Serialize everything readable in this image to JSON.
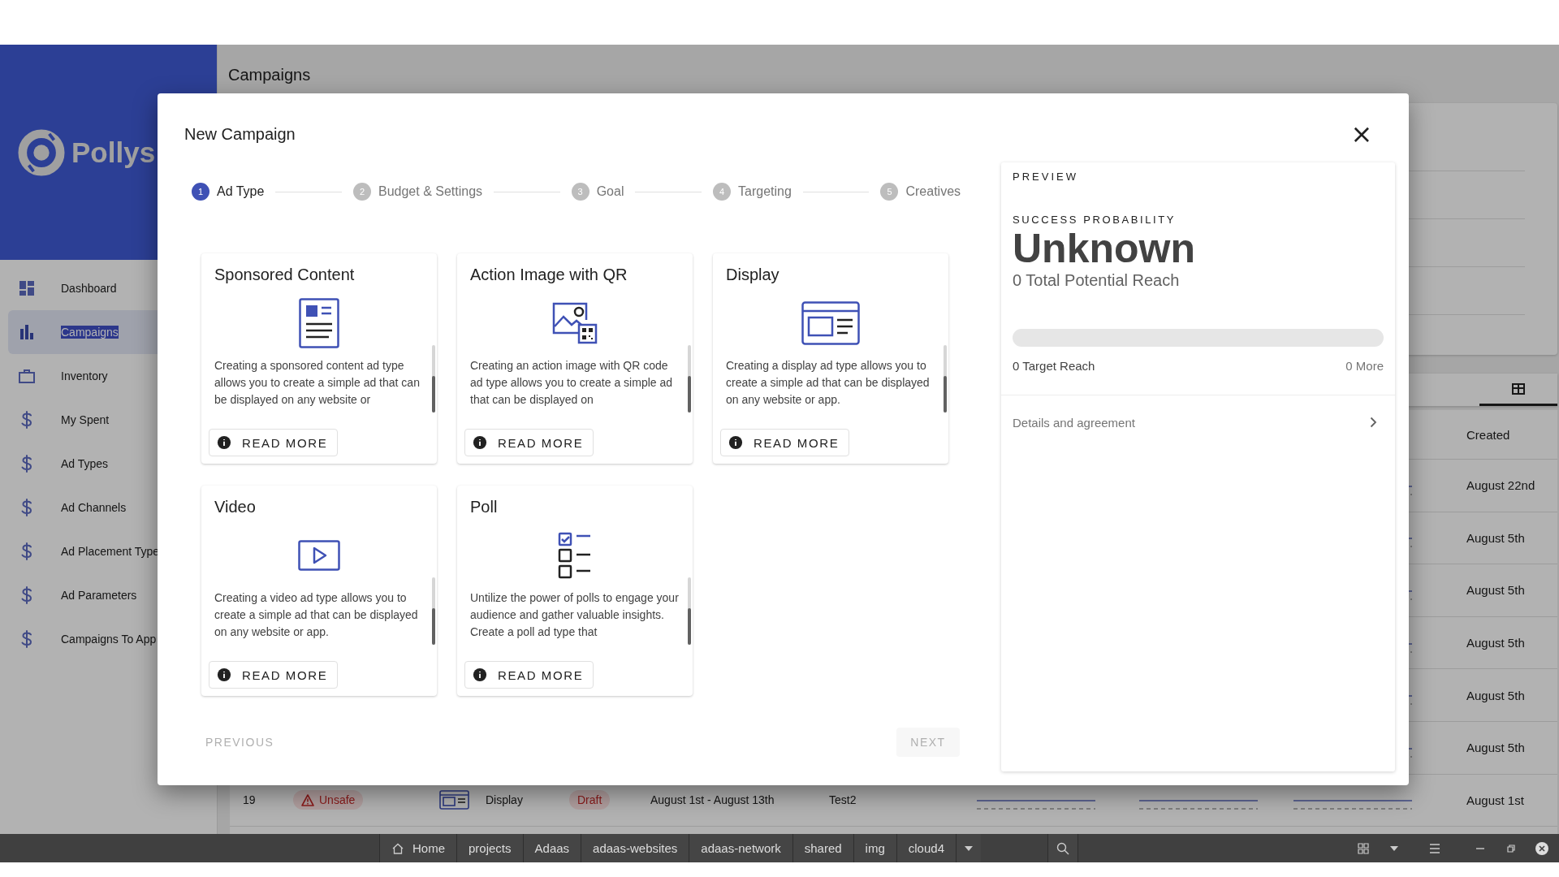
{
  "sidebar": {
    "logo": "Pollys",
    "items": [
      {
        "label": "Dashboard",
        "kind": "dashboard",
        "selected": false
      },
      {
        "label": "Campaigns",
        "kind": "chart",
        "selected": true
      },
      {
        "label": "Inventory",
        "kind": "inventory",
        "selected": false
      },
      {
        "label": "My Spent",
        "kind": "money",
        "selected": false
      },
      {
        "label": "Ad Types",
        "kind": "money",
        "selected": false
      },
      {
        "label": "Ad Channels",
        "kind": "money",
        "selected": false
      },
      {
        "label": "Ad Placement Type",
        "kind": "money",
        "selected": false
      },
      {
        "label": "Ad Parameters",
        "kind": "money",
        "selected": false
      },
      {
        "label": "Campaigns To App",
        "kind": "money",
        "selected": false
      }
    ]
  },
  "header": {
    "title": "Campaigns"
  },
  "view_toggle": {
    "selected": true
  },
  "table": {
    "header": {
      "created": "Created"
    },
    "rows": [
      {
        "created": "August 22nd"
      },
      {
        "created": "August 5th"
      },
      {
        "created": "August 5th"
      },
      {
        "created": "August 5th"
      },
      {
        "created": "August 5th"
      },
      {
        "created": "August 5th"
      },
      {
        "number": "19",
        "safety": "Unsafe",
        "type": "Display",
        "status": "Draft",
        "dates": "August 1st - August 13th",
        "name": "Test2",
        "created": "August 1st"
      }
    ]
  },
  "dialog": {
    "title": "New Campaign",
    "close": "×",
    "steps": [
      {
        "number": "1",
        "label": "Ad Type",
        "selected": true
      },
      {
        "number": "2",
        "label": "Budget & Settings",
        "selected": false
      },
      {
        "number": "3",
        "label": "Goal",
        "selected": false
      },
      {
        "number": "4",
        "label": "Targeting",
        "selected": false
      },
      {
        "number": "5",
        "label": "Creatives",
        "selected": false
      }
    ],
    "ad_types": [
      {
        "kind": "sponsored",
        "title": "Sponsored Content",
        "description": "Creating a sponsored content ad type allows you to create a simple ad that can be displayed on any website or",
        "button": "READ MORE"
      },
      {
        "kind": "qr",
        "title": "Action Image with QR",
        "description": "Creating an action image with QR code ad type allows you to create a simple ad that can be displayed on",
        "button": "READ MORE"
      },
      {
        "kind": "display",
        "title": "Display",
        "description": "Creating a display ad type allows you to create a simple ad that can be displayed on any website or app.",
        "button": "READ MORE"
      },
      {
        "kind": "video",
        "title": "Video",
        "description": "Creating a video ad type allows you to create a simple ad that can be displayed on any website or app.",
        "button": "READ MORE"
      },
      {
        "kind": "poll",
        "title": "Poll",
        "description": "Untilize the power of polls to engage your audience and gather valuable insights. Create a poll ad type that",
        "button": "READ MORE"
      }
    ],
    "previous": {
      "label": "PREVIOUS",
      "disabled": true
    },
    "next": {
      "label": "NEXT",
      "disabled": true
    },
    "preview": {
      "heading": "PREVIEW",
      "probability_label": "SUCCESS PROBABILITY",
      "probability": "Unknown",
      "total_reach": "0 Total Potential Reach",
      "level": 0,
      "target_reach": "0 Target Reach",
      "more": "0 More",
      "details": "Details and agreement"
    }
  },
  "taskbar": {
    "items": [
      {
        "label": "Home",
        "kind": "home"
      },
      {
        "label": "projects"
      },
      {
        "label": "Adaas"
      },
      {
        "label": "adaas-websites"
      },
      {
        "label": "adaas-network"
      },
      {
        "label": "shared"
      },
      {
        "label": "img"
      },
      {
        "label": "cloud4"
      }
    ]
  }
}
